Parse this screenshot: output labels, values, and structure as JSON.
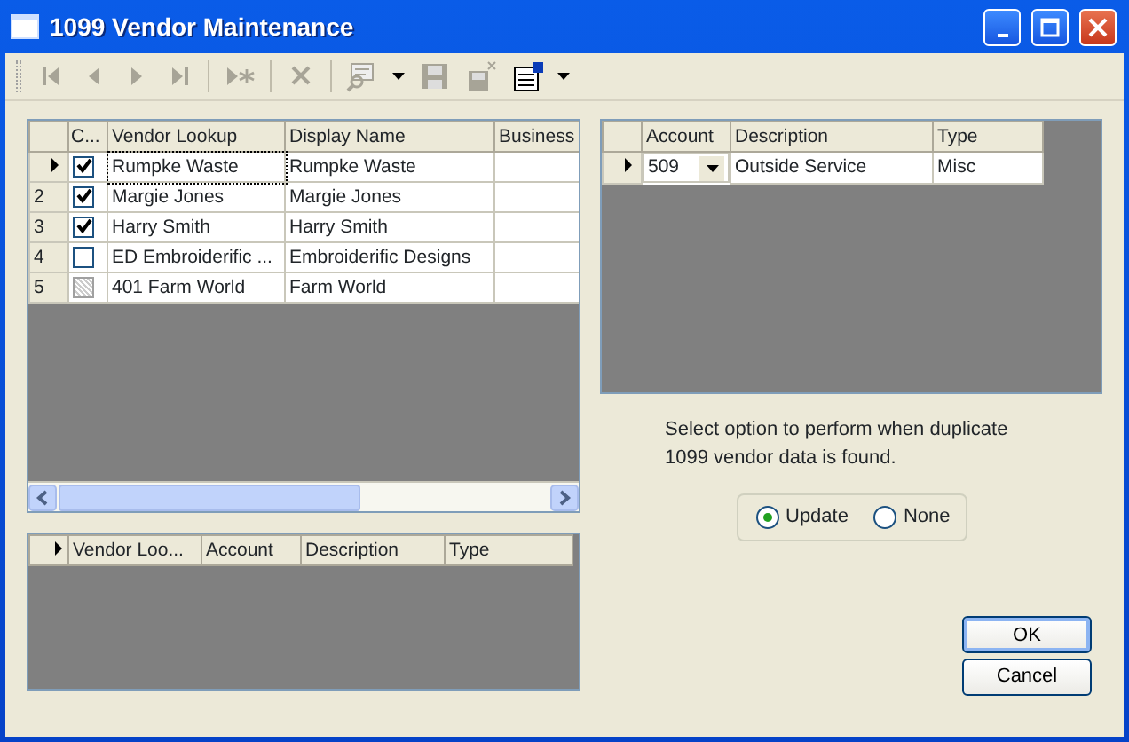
{
  "window": {
    "title": "1099 Vendor Maintenance"
  },
  "toolbar": [
    {
      "kind": "first",
      "disabled": true
    },
    {
      "kind": "previous",
      "disabled": true
    },
    {
      "kind": "next",
      "disabled": true
    },
    {
      "kind": "last",
      "disabled": true
    },
    {
      "kind": "separator"
    },
    {
      "kind": "new",
      "disabled": true
    },
    {
      "kind": "separator"
    },
    {
      "kind": "delete",
      "disabled": true
    },
    {
      "kind": "separator"
    },
    {
      "kind": "find",
      "disabled": true
    },
    {
      "kind": "dropdown",
      "disabled": false
    },
    {
      "kind": "save",
      "disabled": true
    },
    {
      "kind": "save-close",
      "disabled": true
    },
    {
      "kind": "properties",
      "disabled": false
    },
    {
      "kind": "dropdown",
      "disabled": false
    }
  ],
  "vendor_grid": {
    "check_column": "C...",
    "columns": [
      "Vendor Lookup",
      "Display Name",
      "Business"
    ],
    "rows": [
      {
        "selected": true,
        "checked": true,
        "disabled": false,
        "cells": [
          "Rumpke Waste",
          "Rumpke Waste"
        ]
      },
      {
        "row_header": "2",
        "selected": false,
        "checked": true,
        "disabled": false,
        "cells": [
          "Margie Jones",
          "Margie Jones"
        ]
      },
      {
        "row_header": "3",
        "selected": false,
        "checked": true,
        "disabled": false,
        "cells": [
          "Harry Smith",
          "Harry Smith"
        ]
      },
      {
        "row_header": "4",
        "selected": false,
        "checked": false,
        "disabled": false,
        "cells": [
          "ED Embroiderific ...",
          "Embroiderific Designs"
        ]
      },
      {
        "row_header": "5",
        "selected": false,
        "checked": false,
        "disabled": true,
        "cells": [
          "401 Farm World",
          "Farm World"
        ]
      }
    ]
  },
  "duplicate_grid": {
    "columns": [
      "Vendor Loo...",
      "Account",
      "Description",
      "Type"
    ]
  },
  "account_grid": {
    "columns": [
      "Account",
      "Description",
      "Type"
    ],
    "rows": [
      {
        "selected": true,
        "cells": [
          "509",
          "Outside Service",
          "Misc"
        ]
      }
    ]
  },
  "message": "Select option to perform when duplicate 1099 vendor data is found.",
  "options": [
    {
      "label": "Update",
      "selected": true
    },
    {
      "label": "None",
      "selected": false
    }
  ],
  "buttons": [
    {
      "label": "OK",
      "default": true
    },
    {
      "label": "Cancel",
      "default": false
    }
  ]
}
